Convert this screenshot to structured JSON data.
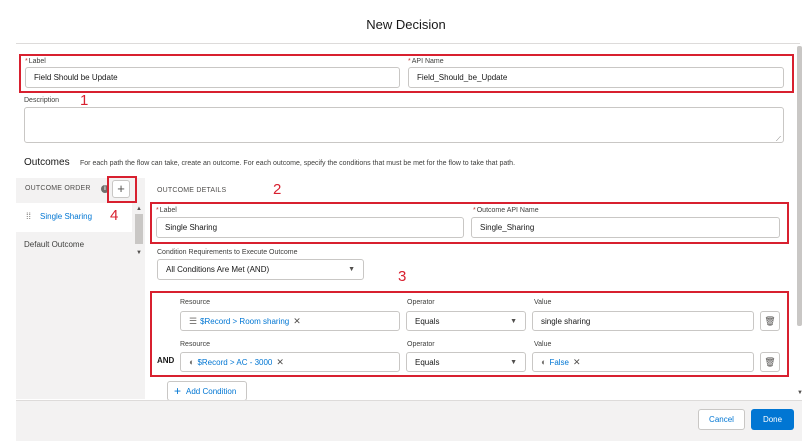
{
  "modal": {
    "title": "New Decision"
  },
  "general": {
    "label_label": "Label",
    "label_value": "Field Should be Update",
    "api_name_label": "API Name",
    "api_name_value": "Field_Should_be_Update",
    "description_label": "Description",
    "description_value": ""
  },
  "outcomes": {
    "title": "Outcomes",
    "hint": "For each path the flow can take, create an outcome. For each outcome, specify the conditions that must be met for the flow to take that path.",
    "order_label": "OUTCOME ORDER",
    "add_symbol": "+",
    "items": [
      {
        "label": "Single Sharing"
      },
      {
        "label": "Default Outcome"
      }
    ]
  },
  "details": {
    "title": "OUTCOME DETAILS",
    "label_label": "Label",
    "label_value": "Single Sharing",
    "api_name_label": "Outcome API Name",
    "api_name_value": "Single_Sharing",
    "condition_req_label": "Condition Requirements to Execute Outcome",
    "condition_req_value": "All Conditions Are Met (AND)",
    "conditions": [
      {
        "prefix": "",
        "resource_label": "Resource",
        "resource_value": "$Record > Room sharing",
        "resource_icon": "picklist-icon",
        "operator_label": "Operator",
        "operator_value": "Equals",
        "value_label": "Value",
        "value_value": "single sharing"
      },
      {
        "prefix": "AND",
        "resource_label": "Resource",
        "resource_value": "$Record > AC - 3000",
        "resource_icon": "toggle-icon",
        "operator_label": "Operator",
        "operator_value": "Equals",
        "value_label": "Value",
        "value_value": "False"
      }
    ],
    "add_condition_label": "Add Condition"
  },
  "annotations": [
    "1",
    "2",
    "3",
    "4"
  ],
  "footer": {
    "cancel_label": "Cancel",
    "done_label": "Done"
  },
  "colors": {
    "accent": "#0176d3",
    "annotation_red": "#d8202f",
    "panel_bg": "#f3f2f2"
  }
}
